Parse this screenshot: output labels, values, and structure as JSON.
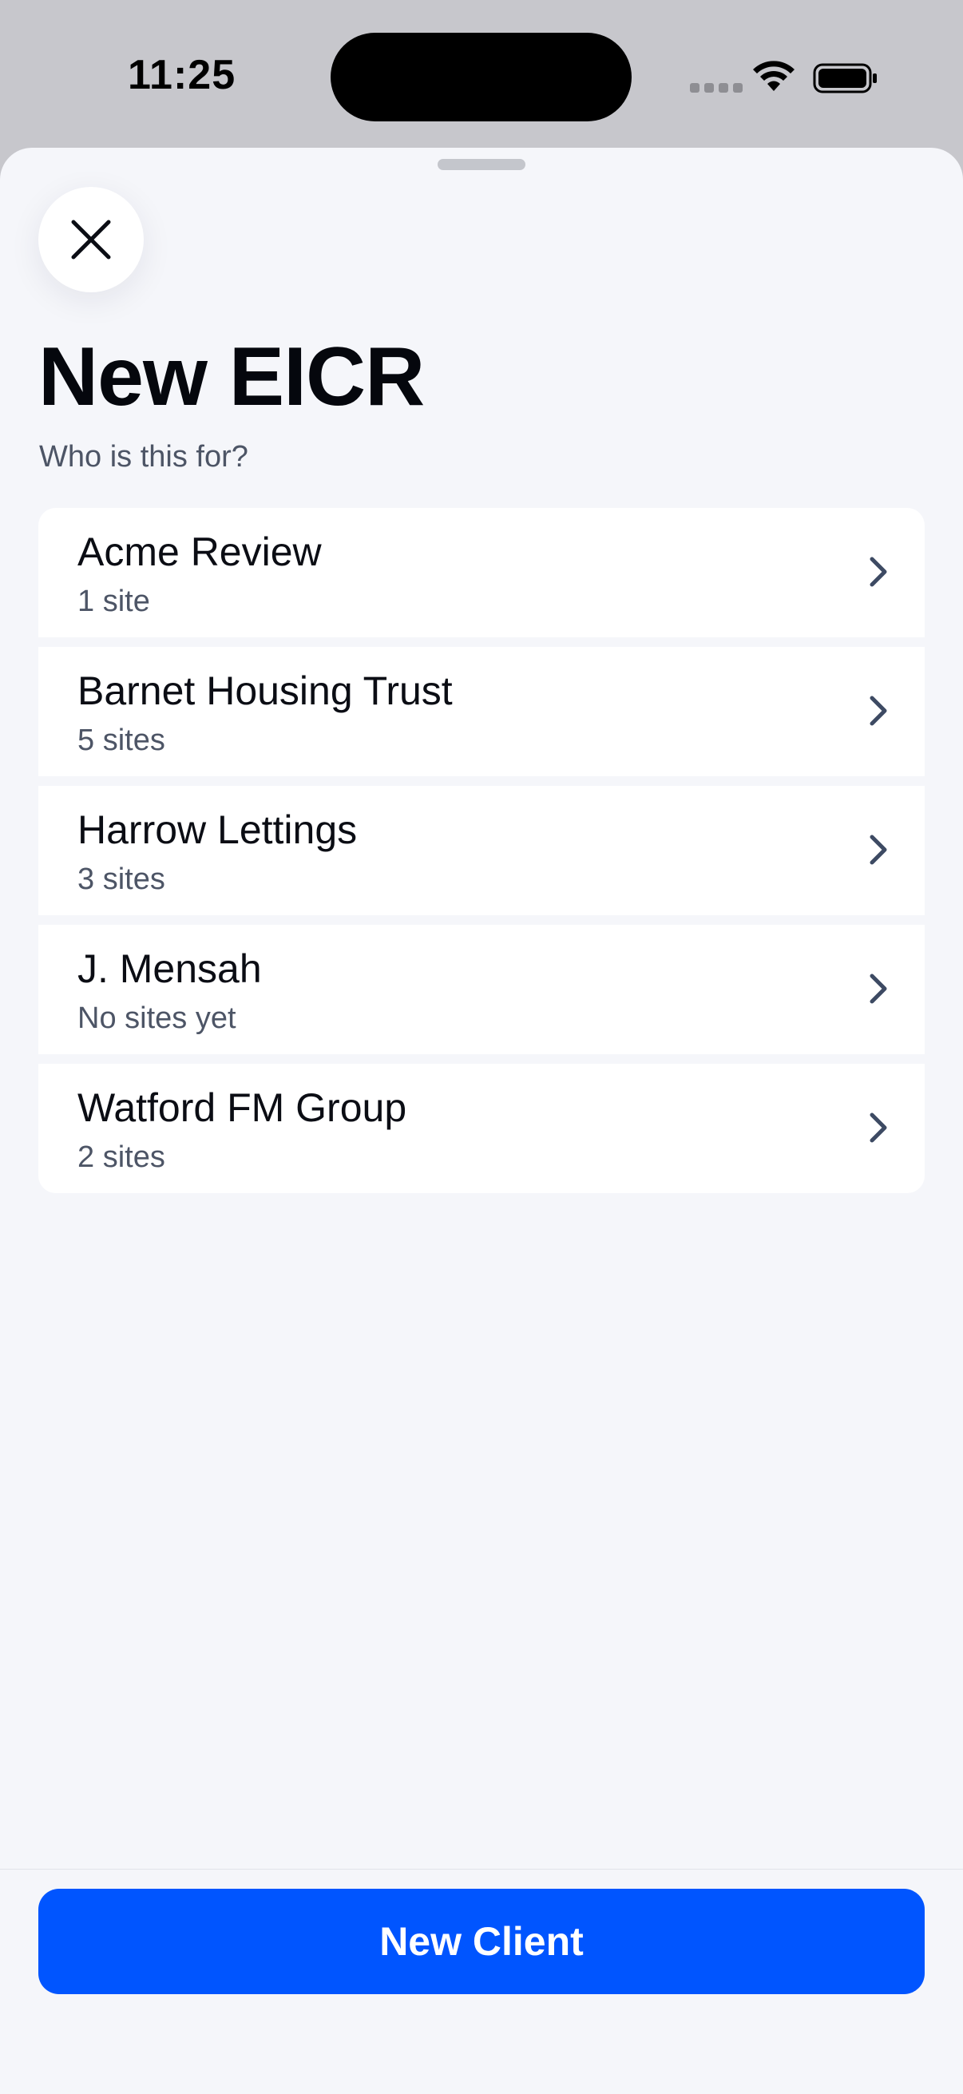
{
  "status_bar": {
    "time": "11:25"
  },
  "header": {
    "close_icon": "close-icon",
    "title": "New EICR",
    "subtitle": "Who is this for?"
  },
  "clients": [
    {
      "name": "Acme Review",
      "sites": "1 site"
    },
    {
      "name": "Barnet Housing Trust",
      "sites": "5 sites"
    },
    {
      "name": "Harrow Lettings",
      "sites": "3 sites"
    },
    {
      "name": "J. Mensah",
      "sites": "No sites yet"
    },
    {
      "name": "Watford FM Group",
      "sites": "2 sites"
    }
  ],
  "footer": {
    "new_client_label": "New Client"
  },
  "colors": {
    "accent": "#0055ff",
    "sheet_background": "#f5f6fa",
    "secondary_text": "#4d5566"
  }
}
